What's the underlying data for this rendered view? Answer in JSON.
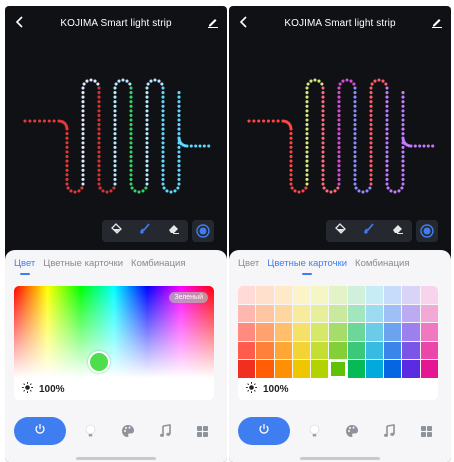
{
  "screens": [
    {
      "title": "KOJIMA  Smart light strip",
      "tabs": [
        "Цвет",
        "Цветные карточки",
        "Комбинация"
      ],
      "active_tab": 0,
      "color_name": "Зеленый",
      "brightness": "100%",
      "strip_colors": [
        "#e23a3a",
        "#dfe8ff",
        "#d33535",
        "#b8e8ff",
        "#37d06b",
        "#b5e9ff",
        "#5fd8ff"
      ]
    },
    {
      "title": "KOJIMA  Smart light strip",
      "tabs": [
        "Цвет",
        "Цветные карточки",
        "Комбинация"
      ],
      "active_tab": 1,
      "brightness": "100%",
      "strip_colors": [
        "#ff4444",
        "#d9e87a",
        "#ff6b7d",
        "#d84cd6",
        "#8a8cff",
        "#ff5c6b",
        "#c07bff"
      ]
    }
  ],
  "swatches": [
    [
      "#ffdad7",
      "#ffe0cd",
      "#ffe9c9",
      "#fbf4c9",
      "#f4f6c6",
      "#e4f2c7",
      "#d0f0dc",
      "#c7ecf6",
      "#c7dcfa",
      "#dad3f8",
      "#f8d3ec"
    ],
    [
      "#ffb8b0",
      "#ffc6a1",
      "#ffd6a0",
      "#f7ec9e",
      "#e6f09a",
      "#c9ea9e",
      "#a3e5bd",
      "#9ddcf0",
      "#9dc0f6",
      "#bcabf3",
      "#f3a8d6"
    ],
    [
      "#ff8a7f",
      "#ffa26d",
      "#ffbf6b",
      "#f5e16a",
      "#d6e868",
      "#a5dc6a",
      "#6dd79a",
      "#6ccbe9",
      "#6ca2f0",
      "#9b80ee",
      "#ef78c0"
    ],
    [
      "#ff5c4e",
      "#ff8038",
      "#ffa735",
      "#f2d436",
      "#c5de34",
      "#83cf38",
      "#3ac978",
      "#37bbe2",
      "#3a84ea",
      "#7a55e8",
      "#ea47a9"
    ],
    [
      "#f02f20",
      "#ff5d06",
      "#ff8f03",
      "#eec700",
      "#b2d300",
      "#5fc206",
      "#06bb56",
      "#02a9dc",
      "#0565e3",
      "#5a2be2",
      "#e41694"
    ]
  ],
  "selected_swatch": [
    4,
    5
  ],
  "colors": {
    "accent": "#3f7ef1",
    "dark_bg": "#101114",
    "panel_bg": "#f6f6f8",
    "picker_color": "#4cde4c"
  },
  "icons": {
    "header": [
      "back-chevron-icon",
      "edit-pencil-icon"
    ],
    "tools": [
      "paint-bucket-icon",
      "brush-icon",
      "eraser-icon",
      "toggle-circle-icon"
    ],
    "nav": [
      "power-icon",
      "bulb-icon",
      "palette-icon",
      "music-icon",
      "grid-icon"
    ]
  }
}
